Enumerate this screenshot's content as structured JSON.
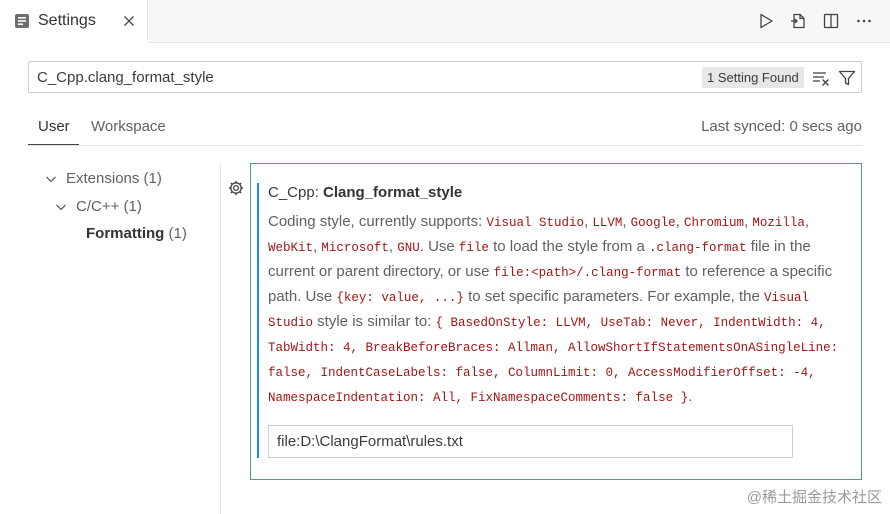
{
  "tab": {
    "title": "Settings"
  },
  "search": {
    "value": "C_Cpp.clang_format_style",
    "result_count": "1 Setting Found"
  },
  "scope_tabs": [
    {
      "label": "User",
      "active": true
    },
    {
      "label": "Workspace",
      "active": false
    }
  ],
  "last_synced": "Last synced: 0 secs ago",
  "toc": [
    {
      "label": "Extensions",
      "count": "(1)"
    },
    {
      "label": "C/C++",
      "count": "(1)"
    },
    {
      "label": "Formatting",
      "count": "(1)"
    }
  ],
  "setting": {
    "category": "C_Cpp:",
    "name": "Clang_format_style",
    "value": "file:D:\\ClangFormat\\rules.txt",
    "description": [
      {
        "t": "Coding style, currently supports: "
      },
      {
        "c": "Visual Studio"
      },
      {
        "t": ", "
      },
      {
        "c": "LLVM"
      },
      {
        "t": ", "
      },
      {
        "c": "Google"
      },
      {
        "t": ", "
      },
      {
        "c": "Chromium"
      },
      {
        "t": ", "
      },
      {
        "c": "Mozilla"
      },
      {
        "t": ", "
      },
      {
        "c": "WebKit"
      },
      {
        "t": ", "
      },
      {
        "c": "Microsoft"
      },
      {
        "t": ", "
      },
      {
        "c": "GNU"
      },
      {
        "t": ". Use "
      },
      {
        "c": "file"
      },
      {
        "t": " to load the style from a "
      },
      {
        "c": ".clang-format"
      },
      {
        "t": " file in the current or parent directory, or use "
      },
      {
        "c": "file:<path>/.clang-format"
      },
      {
        "t": " to reference a specific path. Use "
      },
      {
        "c": "{key: value, ...}"
      },
      {
        "t": " to set specific parameters. For example, the "
      },
      {
        "c": "Visual Studio"
      },
      {
        "t": " style is similar to: "
      },
      {
        "c": "{ BasedOnStyle: LLVM, UseTab: Never, IndentWidth: 4, TabWidth: 4, BreakBeforeBraces: Allman, AllowShortIfStatementsOnASingleLine: false, IndentCaseLabels: false, ColumnLimit: 0, AccessModifierOffset: -4, NamespaceIndentation: All, FixNamespaceComments: false }"
      },
      {
        "t": "."
      }
    ]
  },
  "watermark": "@稀土掘金技术社区",
  "colors": {
    "accent_border": "#4f9e86",
    "modified_bar": "#1a85ff",
    "code_text": "#a31515"
  },
  "icons": {
    "tab": "settings-file-icon",
    "close": "close-icon",
    "run": "run-icon",
    "open_json": "open-json-icon",
    "split": "split-editor-icon",
    "more": "more-icon",
    "clear_filter": "clear-filter-icon",
    "filter": "filter-icon",
    "gear": "gear-icon",
    "chevron": "chevron-down-icon"
  }
}
